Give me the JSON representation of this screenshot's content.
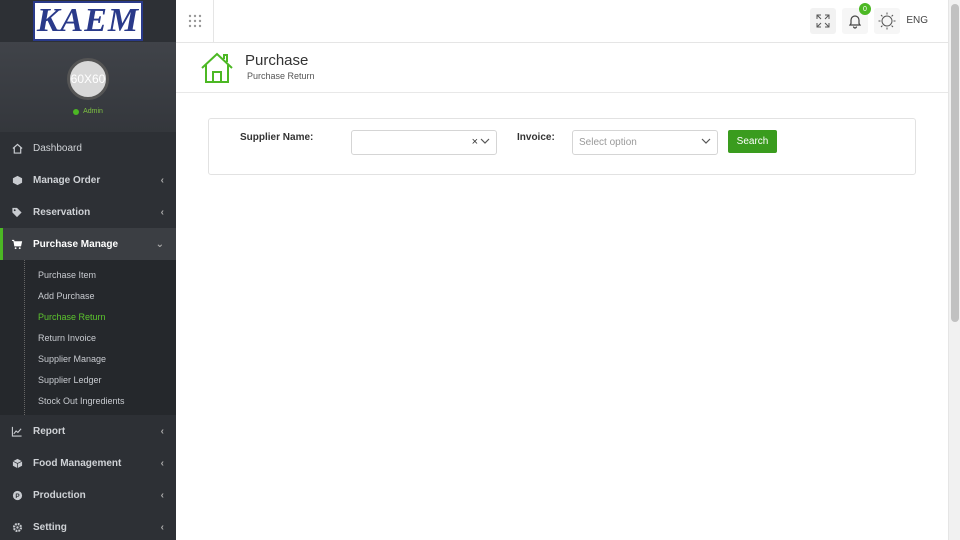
{
  "logo": {
    "text": "KAEM"
  },
  "profile": {
    "avatar_text": "60X60",
    "role": "Admin"
  },
  "nav": {
    "dashboard": "Dashboard",
    "manage_order": "Manage Order",
    "reservation": "Reservation",
    "purchase_manage": "Purchase Manage",
    "purchase_sub": [
      "Purchase Item",
      "Add Purchase",
      "Purchase Return",
      "Return Invoice",
      "Supplier Manage",
      "Supplier Ledger",
      "Stock Out Ingredients"
    ],
    "report": "Report",
    "food_management": "Food Management",
    "production": "Production",
    "setting": "Setting"
  },
  "topbar": {
    "notification_count": "0",
    "language": "ENG"
  },
  "page": {
    "title": "Purchase",
    "subtitle": "Purchase Return"
  },
  "filter": {
    "supplier_label": "Supplier Name:",
    "supplier_value": "",
    "invoice_label": "Invoice:",
    "invoice_placeholder": "Select option",
    "search_button": "Search"
  },
  "colors": {
    "accent": "#4cb824",
    "sidebar_bg": "#2d3035",
    "button": "#3a9c1e"
  }
}
